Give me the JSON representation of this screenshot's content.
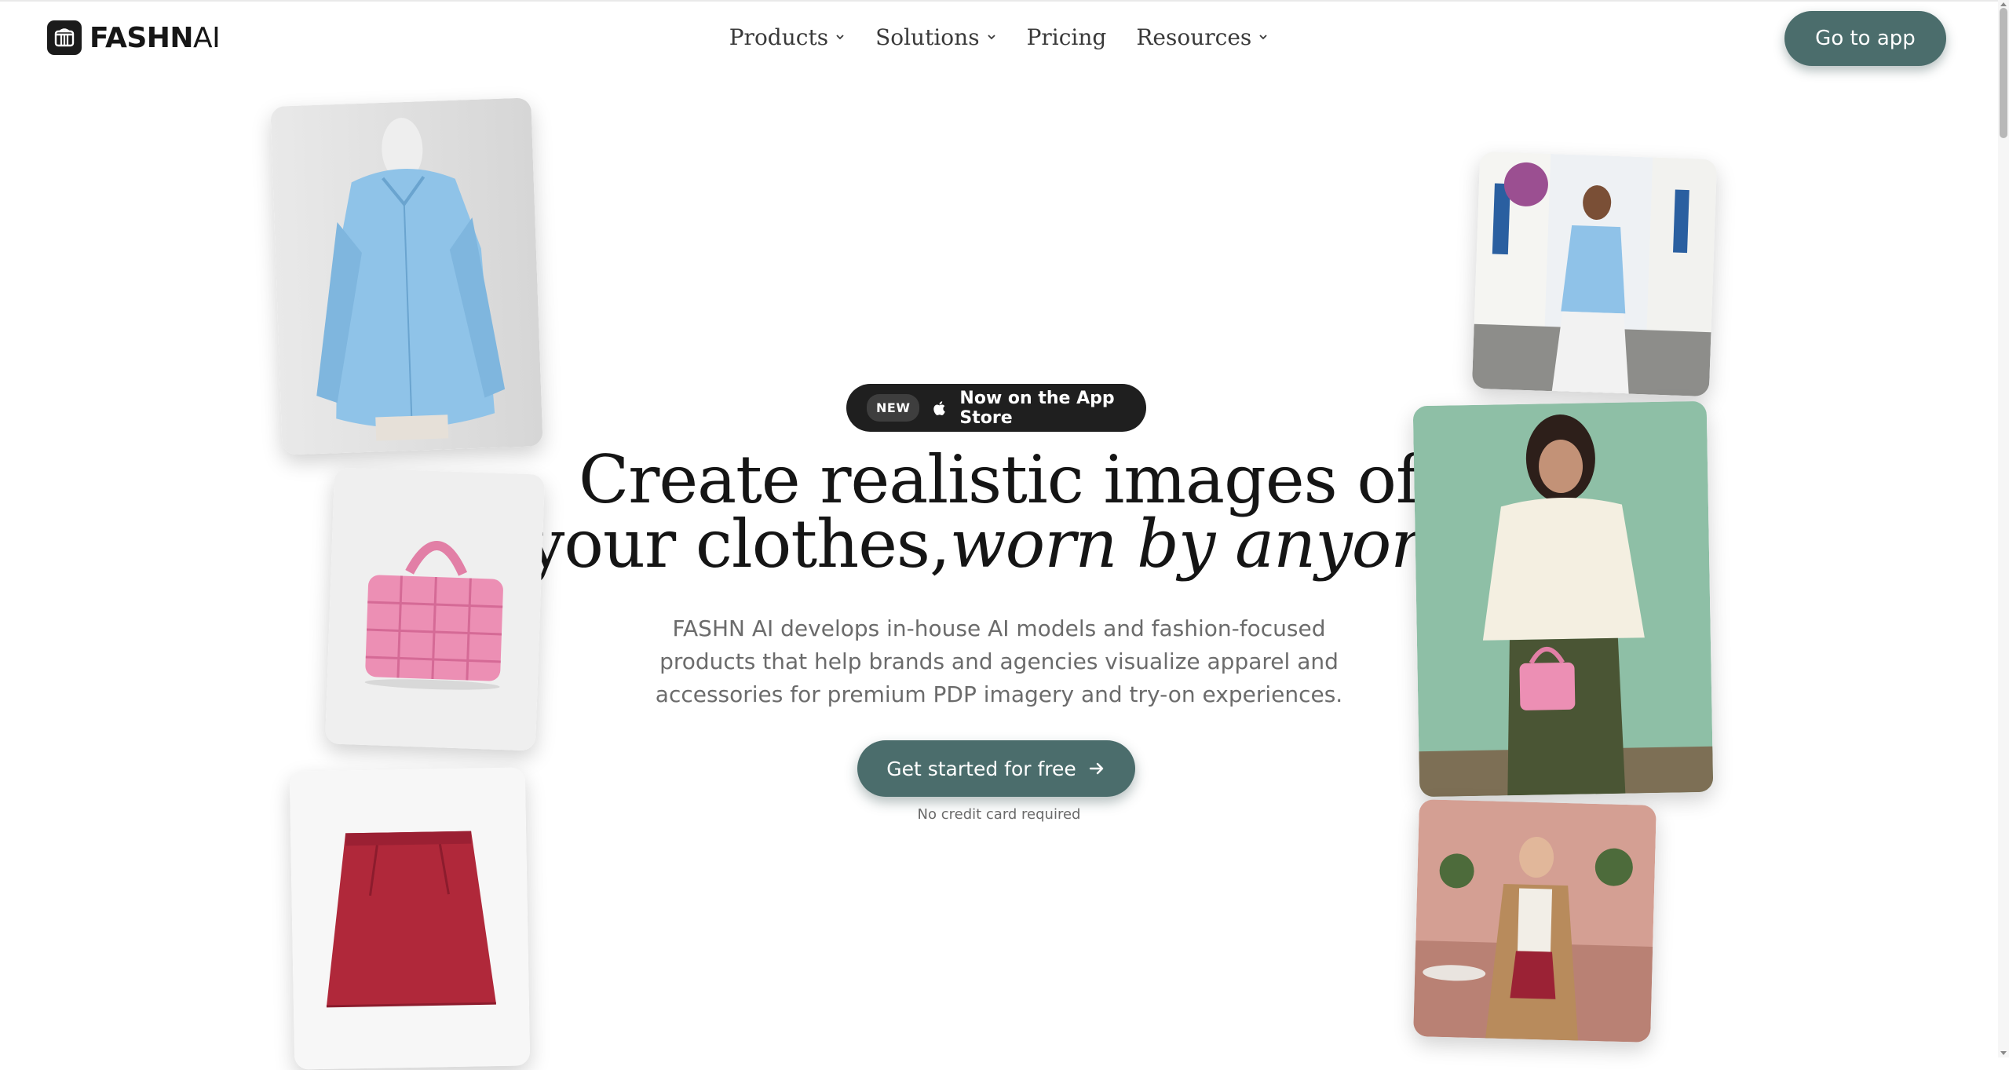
{
  "brand": {
    "name_bold": "FASHN",
    "name_light": "AI"
  },
  "nav": {
    "items": [
      {
        "label": "Products",
        "dropdown": true
      },
      {
        "label": "Solutions",
        "dropdown": true
      },
      {
        "label": "Pricing",
        "dropdown": false
      },
      {
        "label": "Resources",
        "dropdown": true
      }
    ],
    "go_app_label": "Go to app"
  },
  "hero": {
    "badge_tag": "NEW",
    "badge_text": "Now on the App Store",
    "headline_line1": "Create realistic images of",
    "headline_line2_regular": "your clothes,",
    "headline_line2_italic": "worn by anyone",
    "subtitle_line1": "FASHN AI develops in-house AI models and fashion-focused",
    "subtitle_line2": "products that help brands and agencies visualize apparel and",
    "subtitle_line3": "accessories for premium PDP imagery and try-on experiences.",
    "cta_label": "Get started for free",
    "cta_note": "No credit card required"
  },
  "colors": {
    "accent": "#4b6d6c",
    "badge_bg": "#1f1f1f",
    "subtitle": "#6b6b6b"
  },
  "icons": [
    "fashn-logo-icon",
    "chevron-down-icon",
    "apple-icon",
    "arrow-right-icon"
  ],
  "images": [
    {
      "name": "blue-satin-shirt-product-photo"
    },
    {
      "name": "pink-woven-handbag-product-photo"
    },
    {
      "name": "red-leather-skirt-product-photo"
    },
    {
      "name": "model-blue-shirt-street-photo"
    },
    {
      "name": "model-cream-blouse-pink-bag-photo"
    },
    {
      "name": "model-camel-coat-red-skirt-photo"
    }
  ]
}
